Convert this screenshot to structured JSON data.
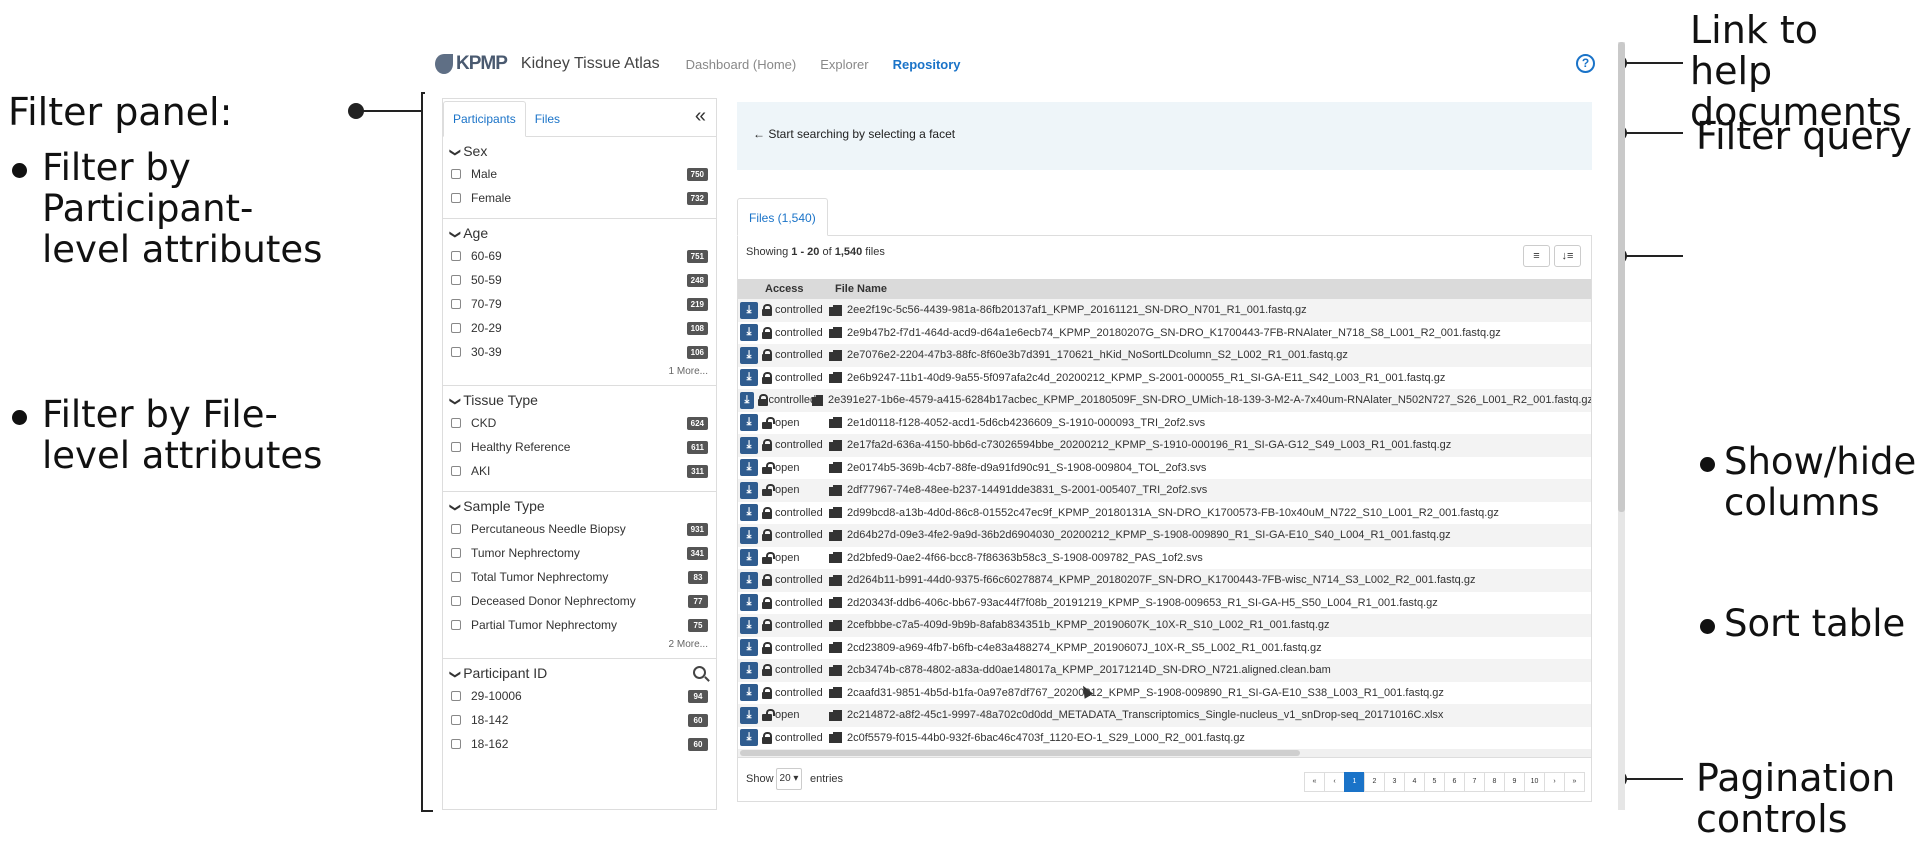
{
  "annotations": {
    "filter_panel": {
      "title": "Filter panel:",
      "bullets": [
        "Filter by Participant-level attributes",
        "Filter by File-level attributes"
      ]
    },
    "help": "Link to help documents",
    "query": "Filter query",
    "columns": [
      "Show/hide columns",
      "Sort table"
    ],
    "pagination": "Pagination controls"
  },
  "header": {
    "logo_text": "KPMP",
    "brand": "Kidney Tissue Atlas",
    "nav": [
      "Dashboard (Home)",
      "Explorer",
      "Repository"
    ],
    "help_icon": "question-circle-icon"
  },
  "panel": {
    "tabs": [
      "Participants",
      "Files"
    ],
    "collapse_icon": "«",
    "facets": {
      "sex": {
        "title": "Sex",
        "items": [
          {
            "label": "Male",
            "count": "750"
          },
          {
            "label": "Female",
            "count": "732"
          }
        ]
      },
      "age": {
        "title": "Age",
        "items": [
          {
            "label": "60-69",
            "count": "751"
          },
          {
            "label": "50-59",
            "count": "248"
          },
          {
            "label": "70-79",
            "count": "219"
          },
          {
            "label": "20-29",
            "count": "108"
          },
          {
            "label": "30-39",
            "count": "106"
          }
        ],
        "more": "1 More..."
      },
      "tissue": {
        "title": "Tissue Type",
        "items": [
          {
            "label": "CKD",
            "count": "624"
          },
          {
            "label": "Healthy Reference",
            "count": "611"
          },
          {
            "label": "AKI",
            "count": "311"
          }
        ]
      },
      "sample": {
        "title": "Sample Type",
        "items": [
          {
            "label": "Percutaneous Needle Biopsy",
            "count": "931"
          },
          {
            "label": "Tumor Nephrectomy",
            "count": "341"
          },
          {
            "label": "Total Tumor Nephrectomy",
            "count": "83"
          },
          {
            "label": "Deceased Donor Nephrectomy",
            "count": "77"
          },
          {
            "label": "Partial Tumor Nephrectomy",
            "count": "75"
          }
        ],
        "more": "2 More..."
      },
      "participant": {
        "title": "Participant ID",
        "items": [
          {
            "label": "29-10006",
            "count": "94"
          },
          {
            "label": "18-142",
            "count": "60"
          },
          {
            "label": "18-162",
            "count": "60"
          }
        ]
      }
    }
  },
  "query": {
    "text": "← Start searching by selecting a facet"
  },
  "files": {
    "tab": "Files (1,540)",
    "showing_prefix": "Showing ",
    "showing_range": "1 - 20",
    "showing_mid": " of ",
    "showing_total": "1,540",
    "showing_suffix": " files",
    "col_btn": "≡",
    "sort_btn": "↓≡",
    "headers": [
      "Access",
      "File Name"
    ],
    "rows": [
      {
        "access": "controlled",
        "name": "2ee2f19c-5c56-4439-981a-86fb20137af1_KPMP_20161121_SN-DRO_N701_R1_001.fastq.gz"
      },
      {
        "access": "controlled",
        "name": "2e9b47b2-f7d1-464d-acd9-d64a1e6ecb74_KPMP_20180207G_SN-DRO_K1700443-7FB-RNAlater_N718_S8_L001_R2_001.fastq.gz"
      },
      {
        "access": "controlled",
        "name": "2e7076e2-2204-47b3-88fc-8f60e3b7d391_170621_hKid_NoSortLDcolumn_S2_L002_R1_001.fastq.gz"
      },
      {
        "access": "controlled",
        "name": "2e6b9247-11b1-40d9-9a55-5f097afa2c4d_20200212_KPMP_S-2001-000055_R1_SI-GA-E11_S42_L003_R1_001.fastq.gz"
      },
      {
        "access": "controlled",
        "name": "2e391e27-1b6e-4579-a415-6284b17acbec_KPMP_20180509F_SN-DRO_UMich-18-139-3-M2-A-7x40um-RNAlater_N502N727_S26_L001_R2_001.fastq.gz"
      },
      {
        "access": "open",
        "name": "2e1d0118-f128-4052-acd1-5d6cb4236609_S-1910-000093_TRI_2of2.svs"
      },
      {
        "access": "controlled",
        "name": "2e17fa2d-636a-4150-bb6d-c73026594bbe_20200212_KPMP_S-1910-000196_R1_SI-GA-G12_S49_L003_R1_001.fastq.gz"
      },
      {
        "access": "open",
        "name": "2e0174b5-369b-4cb7-88fe-d9a91fd90c91_S-1908-009804_TOL_2of3.svs"
      },
      {
        "access": "open",
        "name": "2df77967-74e8-48ee-b237-14491dde3831_S-2001-005407_TRI_2of2.svs"
      },
      {
        "access": "controlled",
        "name": "2d99bcd8-a13b-4d0d-86c8-01552c47ec9f_KPMP_20180131A_SN-DRO_K1700573-FB-10x40uM_N722_S10_L001_R2_001.fastq.gz"
      },
      {
        "access": "controlled",
        "name": "2d64b27d-09e3-4fe2-9a9d-36b2d6904030_20200212_KPMP_S-1908-009890_R1_SI-GA-E10_S40_L004_R1_001.fastq.gz"
      },
      {
        "access": "open",
        "name": "2d2bfed9-0ae2-4f66-bcc8-7f86363b58c3_S-1908-009782_PAS_1of2.svs"
      },
      {
        "access": "controlled",
        "name": "2d264b11-b991-44d0-9375-f66c60278874_KPMP_20180207F_SN-DRO_K1700443-7FB-wisc_N714_S3_L002_R2_001.fastq.gz"
      },
      {
        "access": "controlled",
        "name": "2d20343f-ddb6-406c-bb67-93ac44f7f08b_20191219_KPMP_S-1908-009653_R1_SI-GA-H5_S50_L004_R1_001.fastq.gz"
      },
      {
        "access": "controlled",
        "name": "2cefbbbe-c7a5-409d-9b9b-8afab834351b_KPMP_20190607K_10X-R_S10_L002_R1_001.fastq.gz"
      },
      {
        "access": "controlled",
        "name": "2cd23809-a969-4fb7-b6fb-c4e83a488274_KPMP_20190607J_10X-R_S5_L002_R1_001.fastq.gz"
      },
      {
        "access": "controlled",
        "name": "2cb3474b-c878-4802-a83a-dd0ae148017a_KPMP_20171214D_SN-DRO_N721.aligned.clean.bam"
      },
      {
        "access": "controlled",
        "name": "2caafd31-9851-4b5d-b1fa-0a97e87df767_20200212_KPMP_S-1908-009890_R1_SI-GA-E10_S38_L003_R1_001.fastq.gz"
      },
      {
        "access": "open",
        "name": "2c214872-a8f2-45c1-9997-48a702c0d0dd_METADATA_Transcriptomics_Single-nucleus_v1_snDrop-seq_20171016C.xlsx"
      },
      {
        "access": "controlled",
        "name": "2c0f5579-f015-44b0-932f-6bac46c4703f_1120-EO-1_S29_L000_R2_001.fastq.gz"
      }
    ],
    "footer": {
      "show": "Show",
      "page_size": "20 ▾",
      "entries": "entries",
      "pages": [
        "«",
        "‹",
        "1",
        "2",
        "3",
        "4",
        "5",
        "6",
        "7",
        "8",
        "9",
        "10",
        "›",
        "»"
      ],
      "active_page": "1"
    }
  }
}
